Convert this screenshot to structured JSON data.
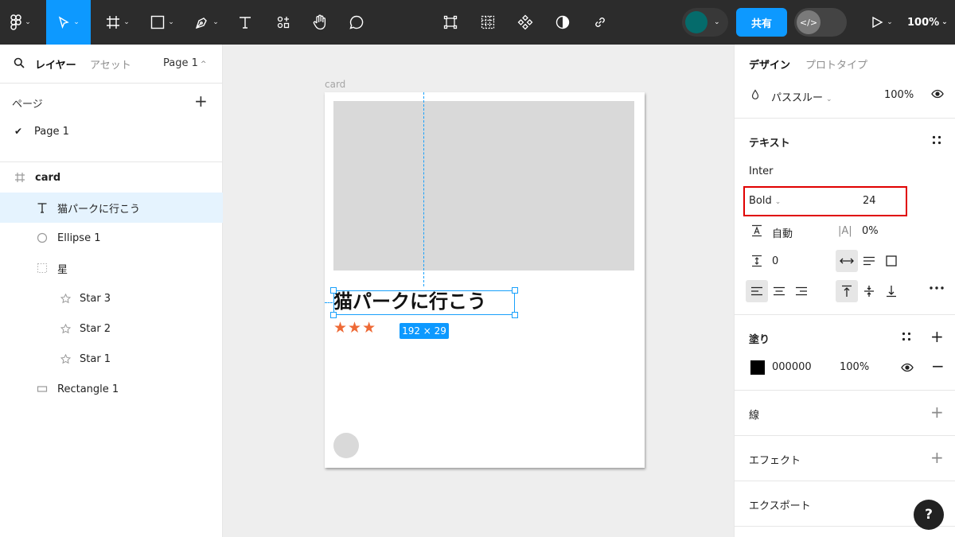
{
  "toolbar": {
    "tools": [
      {
        "name": "main-menu",
        "icon": "figma-logo-icon"
      },
      {
        "name": "move",
        "icon": "pointer-icon",
        "active": true
      },
      {
        "name": "frame",
        "icon": "frame-icon"
      },
      {
        "name": "shape",
        "icon": "rectangle-icon"
      },
      {
        "name": "pen",
        "icon": "pen-icon"
      },
      {
        "name": "text",
        "icon": "text-icon"
      },
      {
        "name": "resources",
        "icon": "resources-icon"
      },
      {
        "name": "hand",
        "icon": "hand-icon"
      },
      {
        "name": "comment",
        "icon": "comment-icon"
      }
    ],
    "center_tools": [
      "selection-icon",
      "grid-icon",
      "component-icon",
      "contrast-icon",
      "link-icon"
    ],
    "share_label": "共有",
    "dev_mode_glyph": "</>",
    "zoom": "100%",
    "accent_color": "#0d99ff",
    "avatar_color": "#056b6b"
  },
  "left_panel": {
    "tab_layers": "レイヤー",
    "tab_assets": "アセット",
    "page_selector": "Page 1",
    "pages_heading": "ページ",
    "pages": [
      {
        "name": "Page 1",
        "current": true
      }
    ],
    "layers": [
      {
        "name": "card",
        "icon": "frame-icon",
        "level": 0,
        "bold": true
      },
      {
        "name": "猫パークに行こう",
        "icon": "text-icon",
        "level": 1,
        "selected": true
      },
      {
        "name": "Ellipse 1",
        "icon": "ellipse-icon",
        "level": 1
      },
      {
        "name": "星",
        "icon": "group-icon",
        "level": 1
      },
      {
        "name": "Star 3",
        "icon": "star-icon",
        "level": 2
      },
      {
        "name": "Star 2",
        "icon": "star-icon",
        "level": 2
      },
      {
        "name": "Star 1",
        "icon": "star-icon",
        "level": 2
      },
      {
        "name": "Rectangle 1",
        "icon": "rectangle-icon",
        "level": 1
      }
    ]
  },
  "canvas": {
    "frame_label": "card",
    "card_title": "猫パークに行こう",
    "stars": "★★★",
    "star_color": "#ee6a36",
    "size_badge": "192 × 29"
  },
  "right_panel": {
    "tab_design": "デザイン",
    "tab_prototype": "プロトタイプ",
    "blend_mode": "パススルー",
    "layer_opacity": "100%",
    "text_section": "テキスト",
    "font_family": "Inter",
    "font_weight": "Bold",
    "font_size": "24",
    "line_height": "自動",
    "letter_spacing_glyph": "|A|",
    "letter_spacing": "0%",
    "paragraph_spacing": "0",
    "fill_section": "塗り",
    "fill_hex": "000000",
    "fill_opacity": "100%",
    "fill_color": "#000000",
    "stroke_section": "線",
    "effects_section": "エフェクト",
    "export_section": "エクスポート",
    "help_label": "?"
  }
}
